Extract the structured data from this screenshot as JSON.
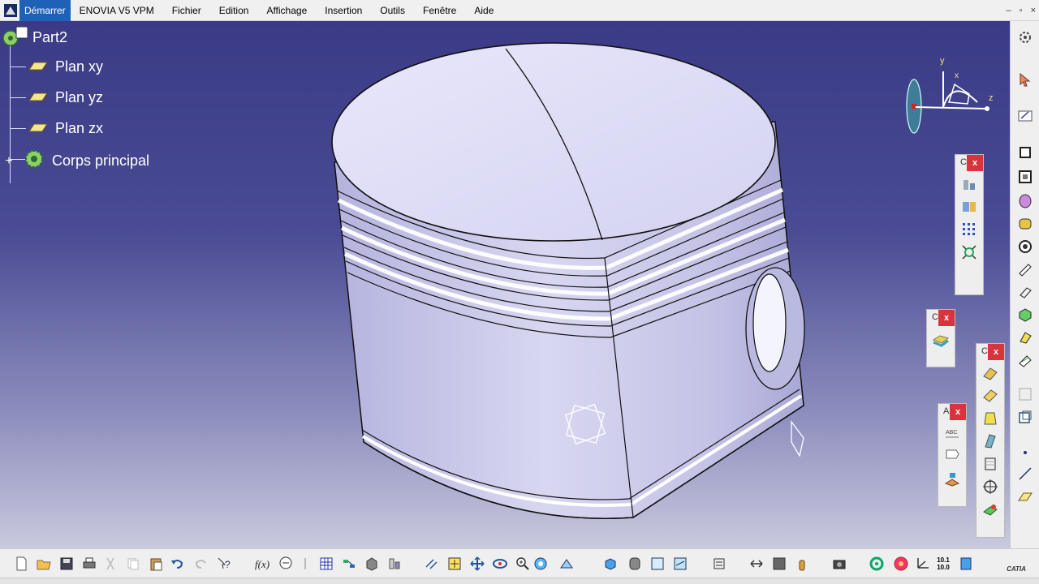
{
  "menu": {
    "items": [
      "Démarrer",
      "ENOVIA V5 VPM",
      "Fichier",
      "Edition",
      "Affichage",
      "Insertion",
      "Outils",
      "Fenêtre",
      "Aide"
    ],
    "window_controls": [
      "–",
      "▫",
      "×"
    ]
  },
  "tree": {
    "root": "Part2",
    "children": [
      "Plan xy",
      "Plan yz",
      "Plan zx",
      "Corps principal"
    ]
  },
  "compass": {
    "x_label": "x",
    "y_label": "y",
    "z_label": "z"
  },
  "floating_toolbars": [
    {
      "caption": "C",
      "close": "x"
    },
    {
      "caption": "C",
      "close": "x"
    },
    {
      "caption": "C",
      "close": "x"
    },
    {
      "caption": "A",
      "close": "x"
    }
  ],
  "bottom_toolbar": {
    "numeric_badge": "10.1\n10.0",
    "brand": "CATIA"
  },
  "colors": {
    "menu_active": "#1e62b8",
    "viewport_top": "#3a3a86",
    "viewport_bottom": "#c9c9de",
    "close_button": "#d9343e",
    "piston_face": "#d9d8f4"
  }
}
